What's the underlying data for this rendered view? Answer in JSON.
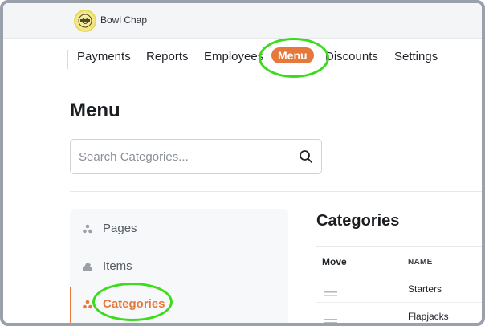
{
  "brand": {
    "name": "Bowl Chap",
    "logo_icon": "bowl-logo-icon"
  },
  "nav": {
    "items": [
      {
        "label": "Payments",
        "active": false
      },
      {
        "label": "Reports",
        "active": false
      },
      {
        "label": "Employees",
        "active": false
      },
      {
        "label": "Menu",
        "active": true
      },
      {
        "label": "Discounts",
        "active": false
      },
      {
        "label": "Settings",
        "active": false
      }
    ]
  },
  "page": {
    "title": "Menu"
  },
  "search": {
    "placeholder": "Search Categories...",
    "value": "",
    "icon": "search-icon"
  },
  "sidebar": {
    "items": [
      {
        "label": "Pages",
        "icon": "pages-icon",
        "active": false
      },
      {
        "label": "Items",
        "icon": "items-icon",
        "active": false
      },
      {
        "label": "Categories",
        "icon": "categories-icon",
        "active": true
      }
    ]
  },
  "categories": {
    "title": "Categories",
    "columns": {
      "move": "Move",
      "name": "NAME"
    },
    "rows": [
      {
        "name": "Starters"
      },
      {
        "name": "Flapjacks"
      }
    ]
  },
  "colors": {
    "accent": "#e5793b",
    "highlight": "#3bdc1b",
    "frame": "#9aa1ab"
  }
}
